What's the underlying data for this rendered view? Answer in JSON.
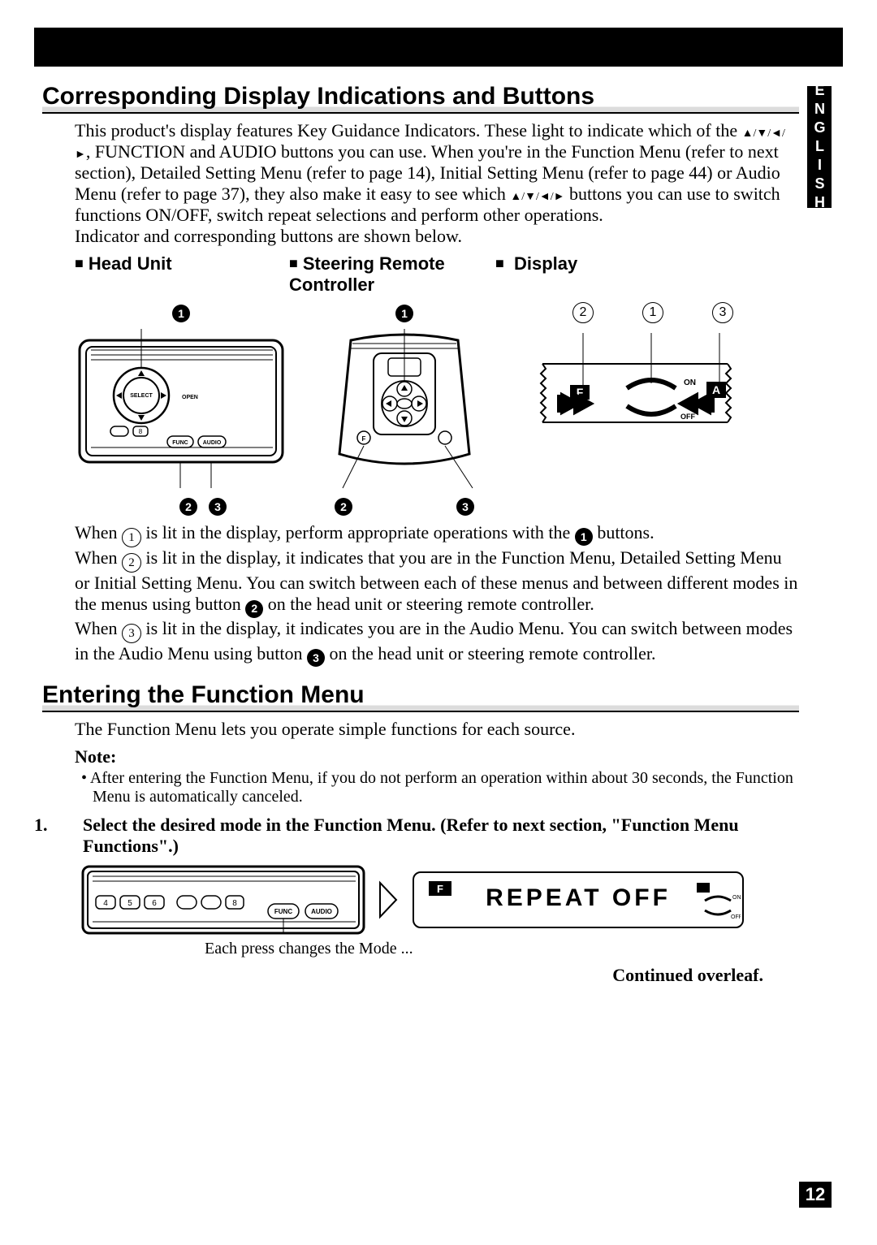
{
  "language_tab": "ENGLISH",
  "page_number": "12",
  "section1": {
    "title": "Corresponding Display Indications and Buttons",
    "para1_a": "This product's display features Key Guidance Indicators. These light to indicate which of the ",
    "arrows": "▲/▼/◄/►",
    "para1_b": ", FUNCTION and AUDIO buttons you can use. When you're in the Function Menu (refer to next section), Detailed Setting Menu (refer to page 14), Initial Setting Menu (refer to page 44) or Audio Menu (refer to page 37), they also make it easy to see which ",
    "para1_c": " buttons you can use to switch functions ON/OFF, switch repeat selections and perform other operations.",
    "para1_d": "Indicator and corresponding buttons are shown below.",
    "labels": {
      "head_unit": "Head Unit",
      "steering": "Steering Remote Controller",
      "display": "Display"
    },
    "head_unit_buttons": {
      "select": "SELECT",
      "open": "OPEN",
      "func": "FUNC",
      "audio": "AUDIO",
      "key8": "8"
    },
    "display_icons": {
      "f": "F",
      "a": "A",
      "on": "ON",
      "off": "OFF"
    },
    "callouts": {
      "black1": "1",
      "black2": "2",
      "black3": "3",
      "white1": "1",
      "white2": "2",
      "white3": "3"
    },
    "para2_line1a": "When ",
    "para2_line1b": " is lit in the display, perform appropriate operations with the ",
    "para2_line1c": " buttons.",
    "para2_line2a": "When ",
    "para2_line2b": " is lit in the display, it indicates that you are in the Function Menu, Detailed Setting Menu or Initial Setting Menu. You can switch between each of these menus and between different modes in the menus using button ",
    "para2_line2c": " on the head unit or steering remote controller.",
    "para2_line3a": "When ",
    "para2_line3b": " is lit in the display, it indicates you are in the Audio Menu. You can switch between modes in the Audio Menu using button ",
    "para2_line3c": " on the head unit or steering remote controller."
  },
  "section2": {
    "title": "Entering the Function Menu",
    "intro": "The Function Menu lets you operate simple functions for each source.",
    "note_label": "Note:",
    "note_body": "• After entering the Function Menu, if you do not perform an operation within about 30 seconds, the Function Menu is automatically canceled.",
    "step1": "Select the desired mode in the Function Menu. (Refer to next section, \"Function Menu Functions\".)",
    "step1_buttons": {
      "n4": "4",
      "n5": "5",
      "n6": "6",
      "n8": "8",
      "func": "FUNC",
      "audio": "AUDIO"
    },
    "lcd_text": "REPEAT  OFF",
    "lcd_f": "F",
    "lcd_on": "ON",
    "lcd_off": "OFF",
    "caption": "Each press changes the Mode ...",
    "continued": "Continued overleaf."
  }
}
